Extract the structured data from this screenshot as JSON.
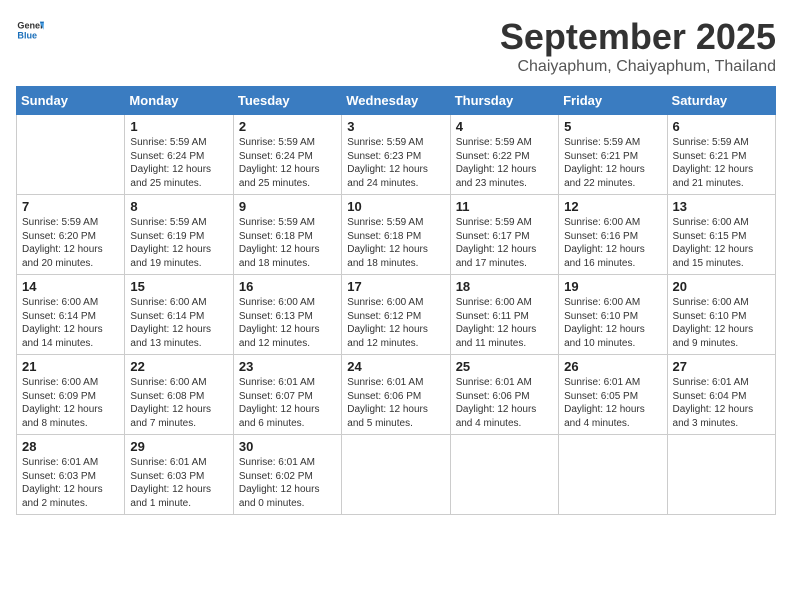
{
  "header": {
    "logo_general": "General",
    "logo_blue": "Blue",
    "month_title": "September 2025",
    "subtitle": "Chaiyaphum, Chaiyaphum, Thailand"
  },
  "days": [
    "Sunday",
    "Monday",
    "Tuesday",
    "Wednesday",
    "Thursday",
    "Friday",
    "Saturday"
  ],
  "weeks": [
    [
      {
        "date": "",
        "info": ""
      },
      {
        "date": "1",
        "info": "Sunrise: 5:59 AM\nSunset: 6:24 PM\nDaylight: 12 hours\nand 25 minutes."
      },
      {
        "date": "2",
        "info": "Sunrise: 5:59 AM\nSunset: 6:24 PM\nDaylight: 12 hours\nand 25 minutes."
      },
      {
        "date": "3",
        "info": "Sunrise: 5:59 AM\nSunset: 6:23 PM\nDaylight: 12 hours\nand 24 minutes."
      },
      {
        "date": "4",
        "info": "Sunrise: 5:59 AM\nSunset: 6:22 PM\nDaylight: 12 hours\nand 23 minutes."
      },
      {
        "date": "5",
        "info": "Sunrise: 5:59 AM\nSunset: 6:21 PM\nDaylight: 12 hours\nand 22 minutes."
      },
      {
        "date": "6",
        "info": "Sunrise: 5:59 AM\nSunset: 6:21 PM\nDaylight: 12 hours\nand 21 minutes."
      }
    ],
    [
      {
        "date": "7",
        "info": "Sunrise: 5:59 AM\nSunset: 6:20 PM\nDaylight: 12 hours\nand 20 minutes."
      },
      {
        "date": "8",
        "info": "Sunrise: 5:59 AM\nSunset: 6:19 PM\nDaylight: 12 hours\nand 19 minutes."
      },
      {
        "date": "9",
        "info": "Sunrise: 5:59 AM\nSunset: 6:18 PM\nDaylight: 12 hours\nand 18 minutes."
      },
      {
        "date": "10",
        "info": "Sunrise: 5:59 AM\nSunset: 6:18 PM\nDaylight: 12 hours\nand 18 minutes."
      },
      {
        "date": "11",
        "info": "Sunrise: 5:59 AM\nSunset: 6:17 PM\nDaylight: 12 hours\nand 17 minutes."
      },
      {
        "date": "12",
        "info": "Sunrise: 6:00 AM\nSunset: 6:16 PM\nDaylight: 12 hours\nand 16 minutes."
      },
      {
        "date": "13",
        "info": "Sunrise: 6:00 AM\nSunset: 6:15 PM\nDaylight: 12 hours\nand 15 minutes."
      }
    ],
    [
      {
        "date": "14",
        "info": "Sunrise: 6:00 AM\nSunset: 6:14 PM\nDaylight: 12 hours\nand 14 minutes."
      },
      {
        "date": "15",
        "info": "Sunrise: 6:00 AM\nSunset: 6:14 PM\nDaylight: 12 hours\nand 13 minutes."
      },
      {
        "date": "16",
        "info": "Sunrise: 6:00 AM\nSunset: 6:13 PM\nDaylight: 12 hours\nand 12 minutes."
      },
      {
        "date": "17",
        "info": "Sunrise: 6:00 AM\nSunset: 6:12 PM\nDaylight: 12 hours\nand 12 minutes."
      },
      {
        "date": "18",
        "info": "Sunrise: 6:00 AM\nSunset: 6:11 PM\nDaylight: 12 hours\nand 11 minutes."
      },
      {
        "date": "19",
        "info": "Sunrise: 6:00 AM\nSunset: 6:10 PM\nDaylight: 12 hours\nand 10 minutes."
      },
      {
        "date": "20",
        "info": "Sunrise: 6:00 AM\nSunset: 6:10 PM\nDaylight: 12 hours\nand 9 minutes."
      }
    ],
    [
      {
        "date": "21",
        "info": "Sunrise: 6:00 AM\nSunset: 6:09 PM\nDaylight: 12 hours\nand 8 minutes."
      },
      {
        "date": "22",
        "info": "Sunrise: 6:00 AM\nSunset: 6:08 PM\nDaylight: 12 hours\nand 7 minutes."
      },
      {
        "date": "23",
        "info": "Sunrise: 6:01 AM\nSunset: 6:07 PM\nDaylight: 12 hours\nand 6 minutes."
      },
      {
        "date": "24",
        "info": "Sunrise: 6:01 AM\nSunset: 6:06 PM\nDaylight: 12 hours\nand 5 minutes."
      },
      {
        "date": "25",
        "info": "Sunrise: 6:01 AM\nSunset: 6:06 PM\nDaylight: 12 hours\nand 4 minutes."
      },
      {
        "date": "26",
        "info": "Sunrise: 6:01 AM\nSunset: 6:05 PM\nDaylight: 12 hours\nand 4 minutes."
      },
      {
        "date": "27",
        "info": "Sunrise: 6:01 AM\nSunset: 6:04 PM\nDaylight: 12 hours\nand 3 minutes."
      }
    ],
    [
      {
        "date": "28",
        "info": "Sunrise: 6:01 AM\nSunset: 6:03 PM\nDaylight: 12 hours\nand 2 minutes."
      },
      {
        "date": "29",
        "info": "Sunrise: 6:01 AM\nSunset: 6:03 PM\nDaylight: 12 hours\nand 1 minute."
      },
      {
        "date": "30",
        "info": "Sunrise: 6:01 AM\nSunset: 6:02 PM\nDaylight: 12 hours\nand 0 minutes."
      },
      {
        "date": "",
        "info": ""
      },
      {
        "date": "",
        "info": ""
      },
      {
        "date": "",
        "info": ""
      },
      {
        "date": "",
        "info": ""
      }
    ]
  ]
}
